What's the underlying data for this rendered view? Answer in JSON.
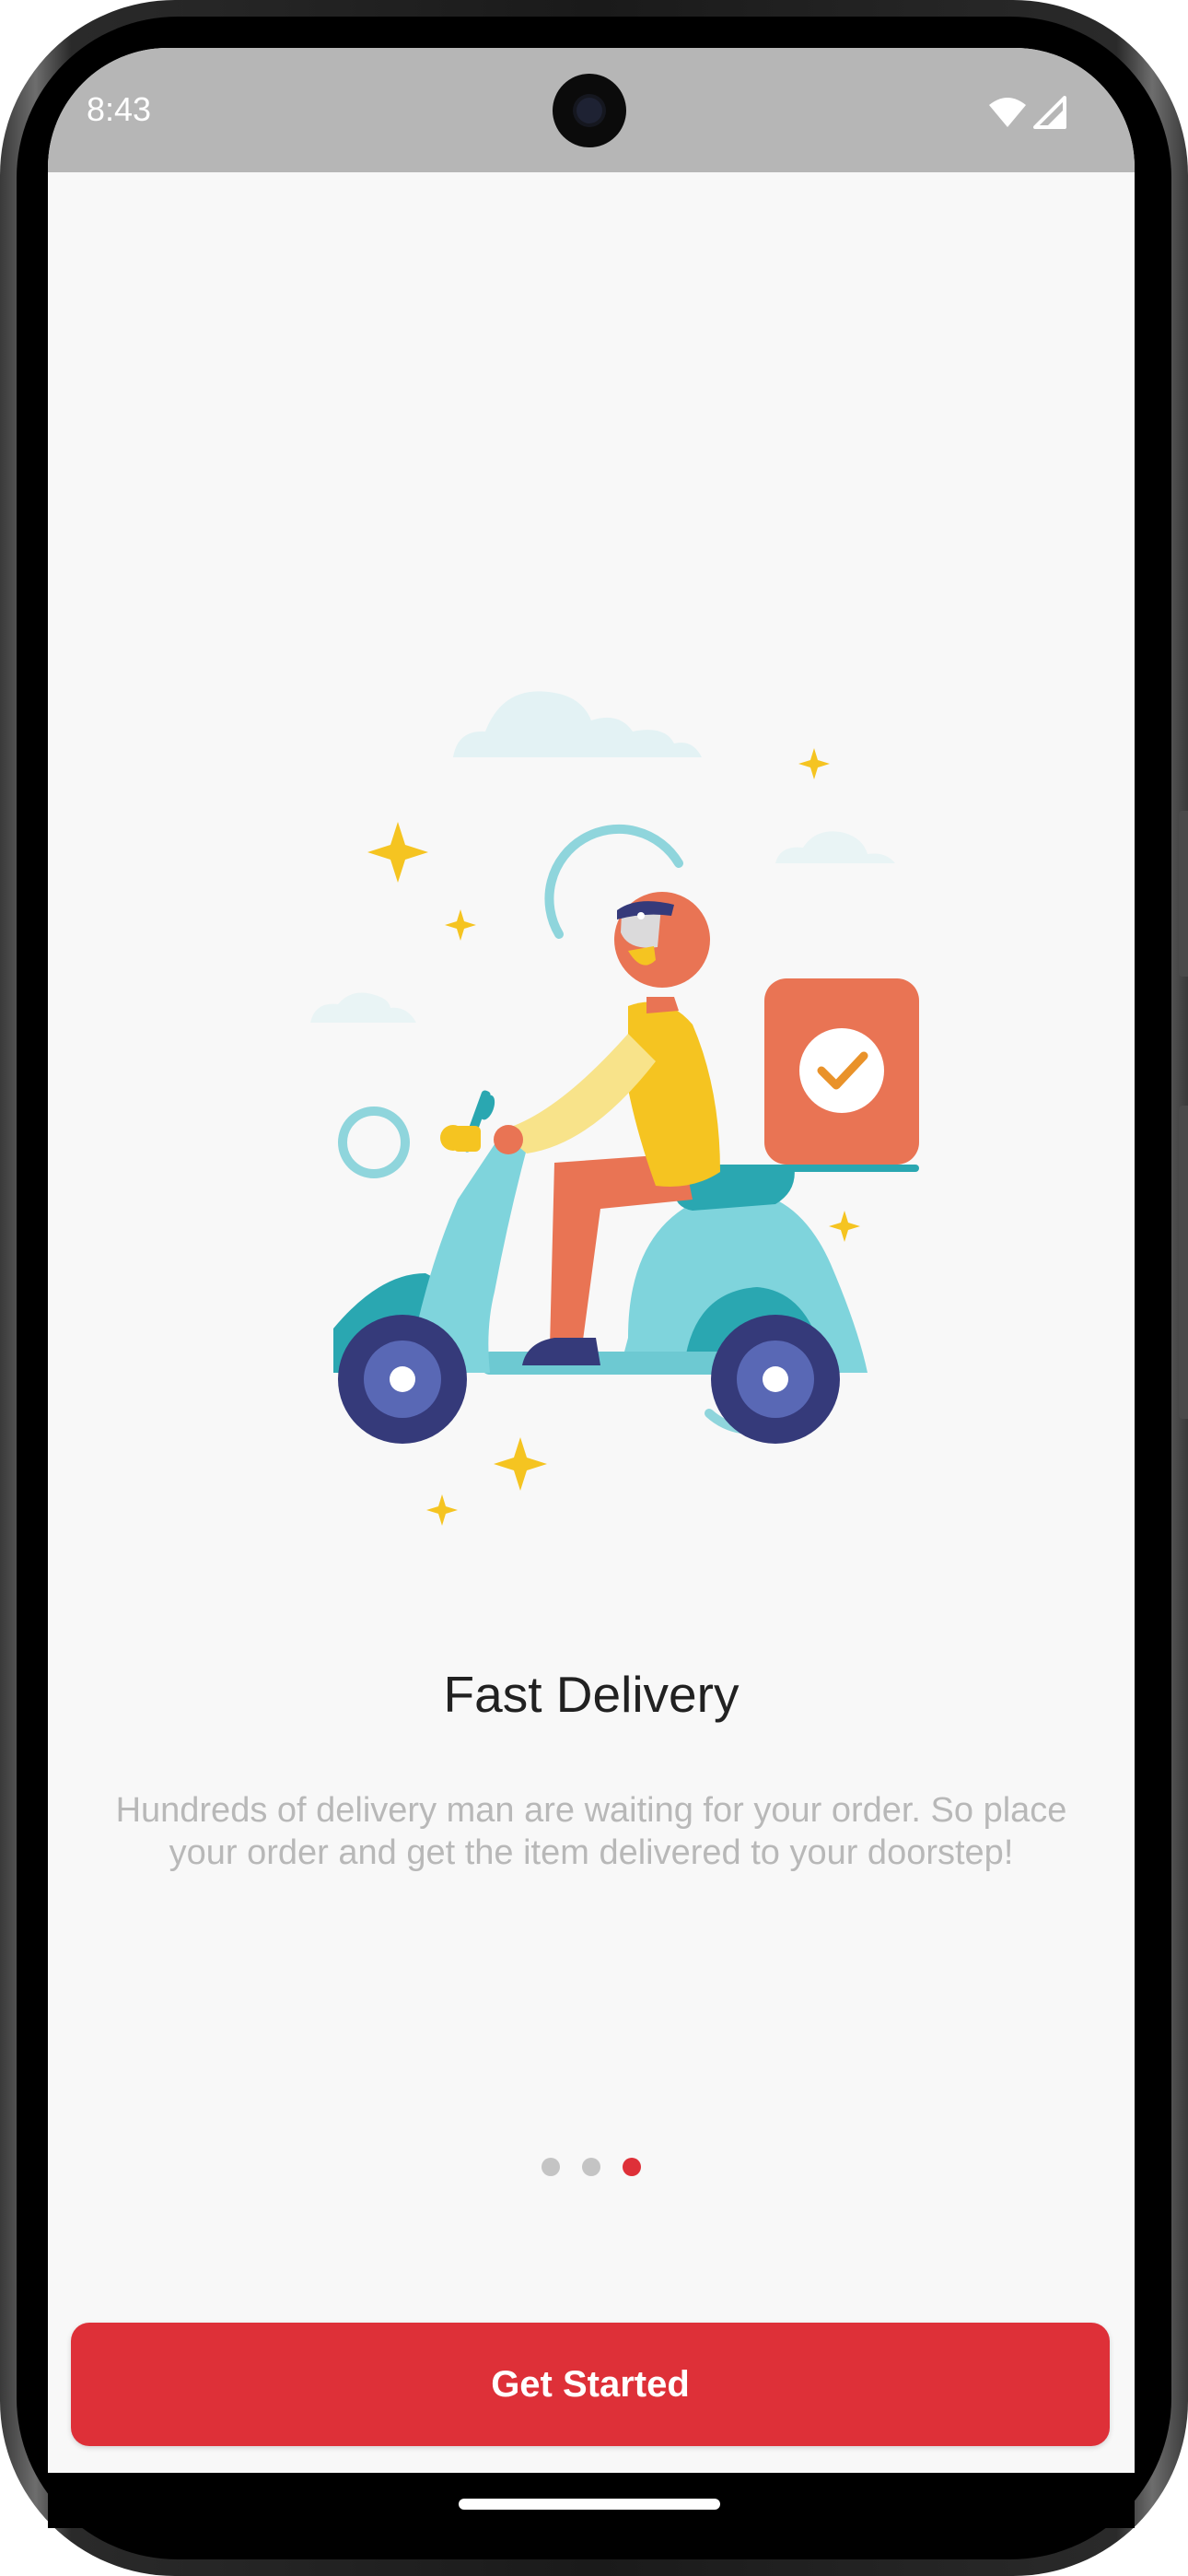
{
  "status_bar": {
    "time": "8:43",
    "wifi_icon": "wifi-icon",
    "signal_icon": "cellular-signal-icon"
  },
  "illustration": {
    "icon": "delivery-scooter-illustration"
  },
  "onboarding": {
    "title": "Fast Delivery",
    "description": "Hundreds of delivery man are waiting for your order. So place your order and get the item delivered to your doorstep!",
    "page_count": 3,
    "current_page": 3
  },
  "actions": {
    "get_started_label": "Get Started"
  },
  "colors": {
    "accent": "#de3038",
    "status_bar": "#b6b6b6",
    "background": "#f8f8f8",
    "dot_inactive": "#c4c4c4"
  }
}
